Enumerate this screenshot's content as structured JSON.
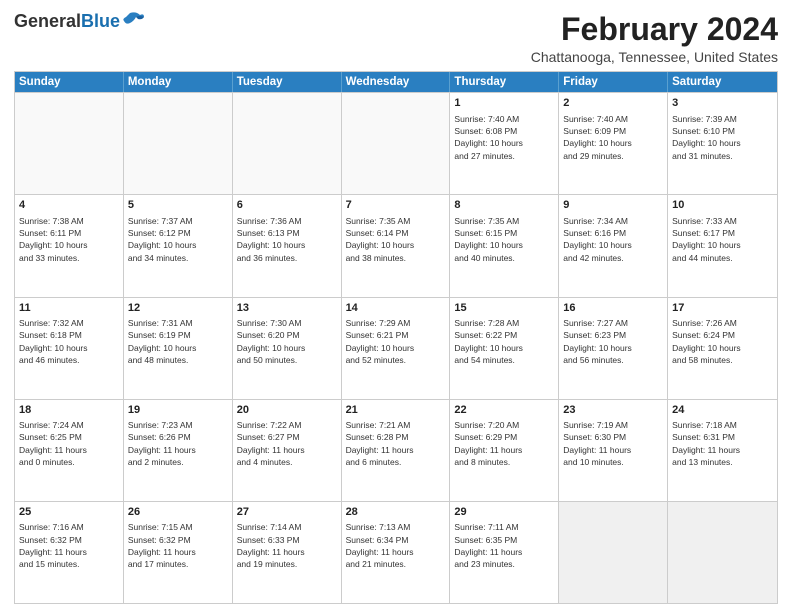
{
  "logo": {
    "line1": "General",
    "line2": "Blue"
  },
  "title": "February 2024",
  "subtitle": "Chattanooga, Tennessee, United States",
  "days_of_week": [
    "Sunday",
    "Monday",
    "Tuesday",
    "Wednesday",
    "Thursday",
    "Friday",
    "Saturday"
  ],
  "weeks": [
    [
      {
        "day": "",
        "info": ""
      },
      {
        "day": "",
        "info": ""
      },
      {
        "day": "",
        "info": ""
      },
      {
        "day": "",
        "info": ""
      },
      {
        "day": "1",
        "info": "Sunrise: 7:40 AM\nSunset: 6:08 PM\nDaylight: 10 hours\nand 27 minutes."
      },
      {
        "day": "2",
        "info": "Sunrise: 7:40 AM\nSunset: 6:09 PM\nDaylight: 10 hours\nand 29 minutes."
      },
      {
        "day": "3",
        "info": "Sunrise: 7:39 AM\nSunset: 6:10 PM\nDaylight: 10 hours\nand 31 minutes."
      }
    ],
    [
      {
        "day": "4",
        "info": "Sunrise: 7:38 AM\nSunset: 6:11 PM\nDaylight: 10 hours\nand 33 minutes."
      },
      {
        "day": "5",
        "info": "Sunrise: 7:37 AM\nSunset: 6:12 PM\nDaylight: 10 hours\nand 34 minutes."
      },
      {
        "day": "6",
        "info": "Sunrise: 7:36 AM\nSunset: 6:13 PM\nDaylight: 10 hours\nand 36 minutes."
      },
      {
        "day": "7",
        "info": "Sunrise: 7:35 AM\nSunset: 6:14 PM\nDaylight: 10 hours\nand 38 minutes."
      },
      {
        "day": "8",
        "info": "Sunrise: 7:35 AM\nSunset: 6:15 PM\nDaylight: 10 hours\nand 40 minutes."
      },
      {
        "day": "9",
        "info": "Sunrise: 7:34 AM\nSunset: 6:16 PM\nDaylight: 10 hours\nand 42 minutes."
      },
      {
        "day": "10",
        "info": "Sunrise: 7:33 AM\nSunset: 6:17 PM\nDaylight: 10 hours\nand 44 minutes."
      }
    ],
    [
      {
        "day": "11",
        "info": "Sunrise: 7:32 AM\nSunset: 6:18 PM\nDaylight: 10 hours\nand 46 minutes."
      },
      {
        "day": "12",
        "info": "Sunrise: 7:31 AM\nSunset: 6:19 PM\nDaylight: 10 hours\nand 48 minutes."
      },
      {
        "day": "13",
        "info": "Sunrise: 7:30 AM\nSunset: 6:20 PM\nDaylight: 10 hours\nand 50 minutes."
      },
      {
        "day": "14",
        "info": "Sunrise: 7:29 AM\nSunset: 6:21 PM\nDaylight: 10 hours\nand 52 minutes."
      },
      {
        "day": "15",
        "info": "Sunrise: 7:28 AM\nSunset: 6:22 PM\nDaylight: 10 hours\nand 54 minutes."
      },
      {
        "day": "16",
        "info": "Sunrise: 7:27 AM\nSunset: 6:23 PM\nDaylight: 10 hours\nand 56 minutes."
      },
      {
        "day": "17",
        "info": "Sunrise: 7:26 AM\nSunset: 6:24 PM\nDaylight: 10 hours\nand 58 minutes."
      }
    ],
    [
      {
        "day": "18",
        "info": "Sunrise: 7:24 AM\nSunset: 6:25 PM\nDaylight: 11 hours\nand 0 minutes."
      },
      {
        "day": "19",
        "info": "Sunrise: 7:23 AM\nSunset: 6:26 PM\nDaylight: 11 hours\nand 2 minutes."
      },
      {
        "day": "20",
        "info": "Sunrise: 7:22 AM\nSunset: 6:27 PM\nDaylight: 11 hours\nand 4 minutes."
      },
      {
        "day": "21",
        "info": "Sunrise: 7:21 AM\nSunset: 6:28 PM\nDaylight: 11 hours\nand 6 minutes."
      },
      {
        "day": "22",
        "info": "Sunrise: 7:20 AM\nSunset: 6:29 PM\nDaylight: 11 hours\nand 8 minutes."
      },
      {
        "day": "23",
        "info": "Sunrise: 7:19 AM\nSunset: 6:30 PM\nDaylight: 11 hours\nand 10 minutes."
      },
      {
        "day": "24",
        "info": "Sunrise: 7:18 AM\nSunset: 6:31 PM\nDaylight: 11 hours\nand 13 minutes."
      }
    ],
    [
      {
        "day": "25",
        "info": "Sunrise: 7:16 AM\nSunset: 6:32 PM\nDaylight: 11 hours\nand 15 minutes."
      },
      {
        "day": "26",
        "info": "Sunrise: 7:15 AM\nSunset: 6:32 PM\nDaylight: 11 hours\nand 17 minutes."
      },
      {
        "day": "27",
        "info": "Sunrise: 7:14 AM\nSunset: 6:33 PM\nDaylight: 11 hours\nand 19 minutes."
      },
      {
        "day": "28",
        "info": "Sunrise: 7:13 AM\nSunset: 6:34 PM\nDaylight: 11 hours\nand 21 minutes."
      },
      {
        "day": "29",
        "info": "Sunrise: 7:11 AM\nSunset: 6:35 PM\nDaylight: 11 hours\nand 23 minutes."
      },
      {
        "day": "",
        "info": ""
      },
      {
        "day": "",
        "info": ""
      }
    ]
  ]
}
